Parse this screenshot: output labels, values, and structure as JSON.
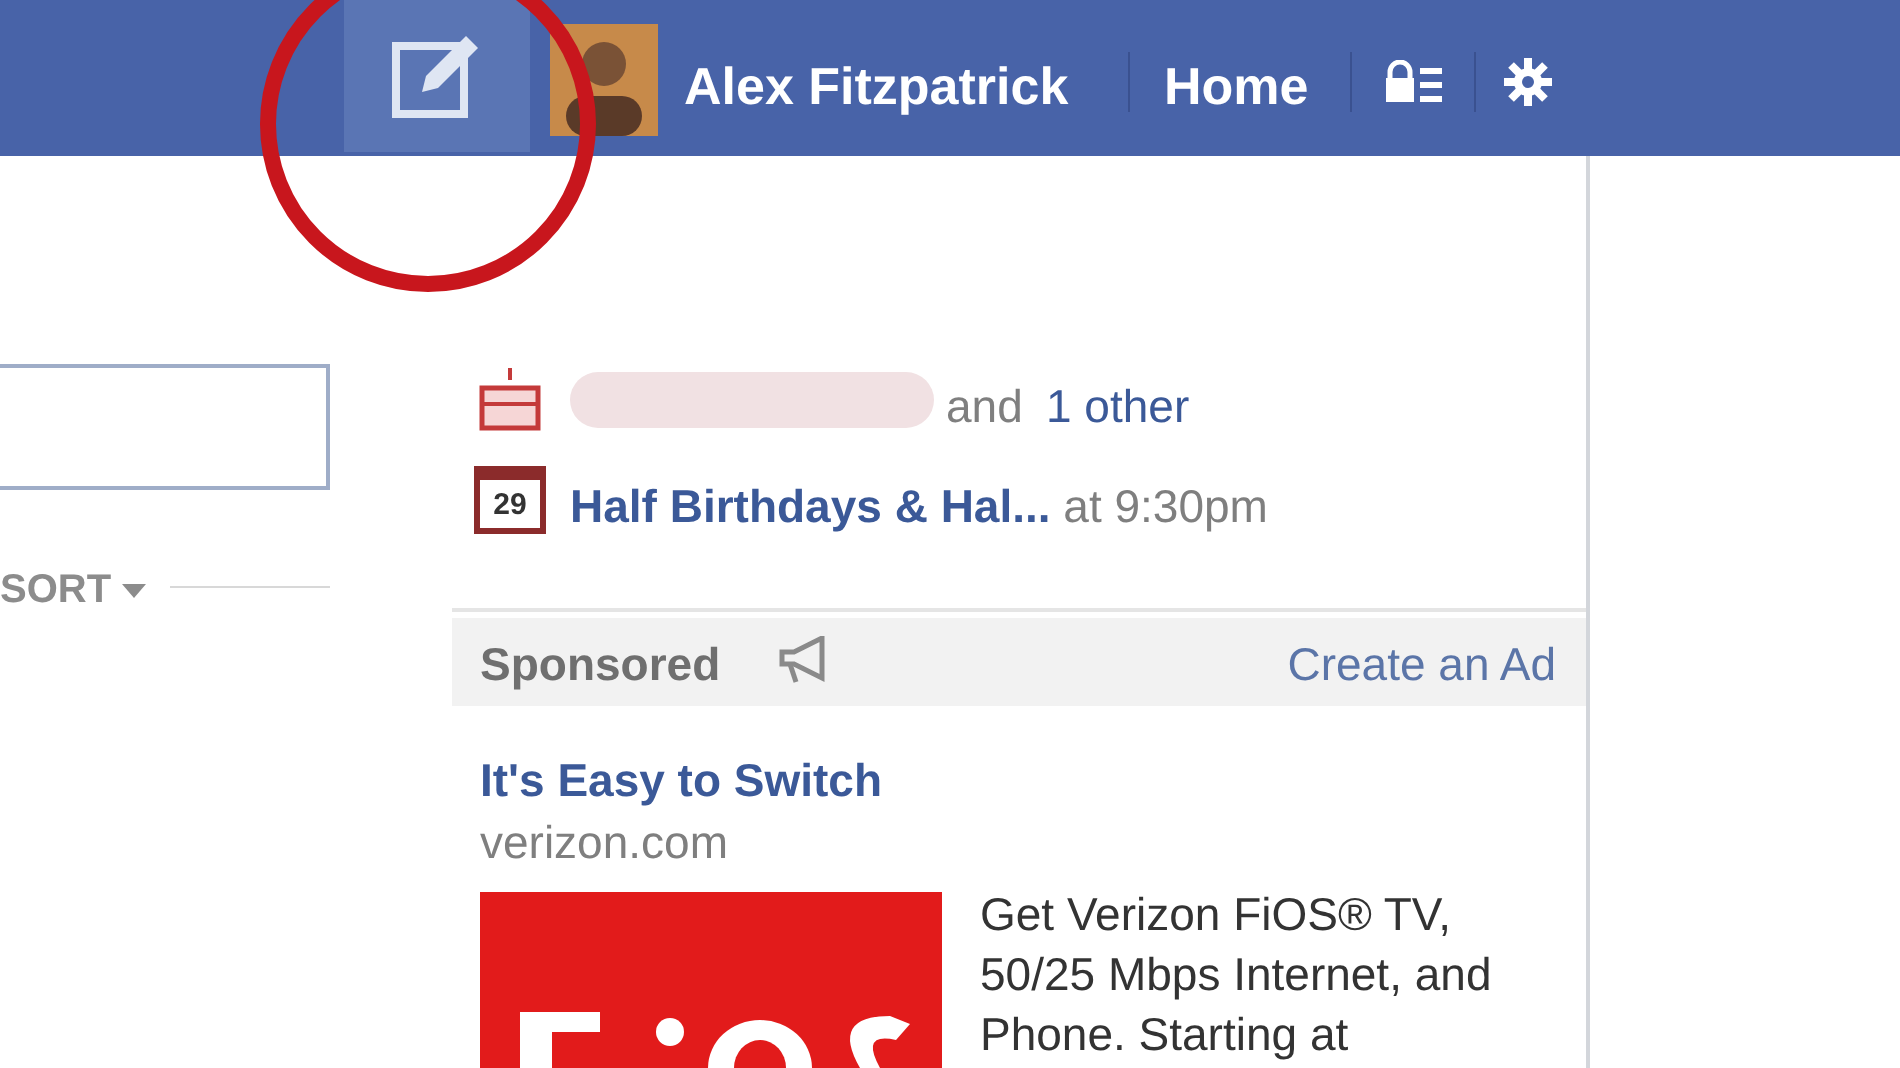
{
  "top_bar": {
    "user_name": "Alex Fitzpatrick",
    "home": "Home"
  },
  "left": {
    "sort_label": "SORT"
  },
  "reminders": [
    {
      "kind": "birthday",
      "connector": "and",
      "link": "1 other"
    },
    {
      "kind": "event",
      "day": "29",
      "title": "Half Birthdays & Hal...",
      "time": "at 9:30pm"
    }
  ],
  "sponsored": {
    "title": "Sponsored",
    "create_link": "Create an Ad",
    "ad": {
      "headline": "It's Easy to Switch",
      "domain": "verizon.com",
      "body": "Get Verizon FiOS® TV, 50/25 Mbps Internet, and Phone. Starting at"
    }
  }
}
